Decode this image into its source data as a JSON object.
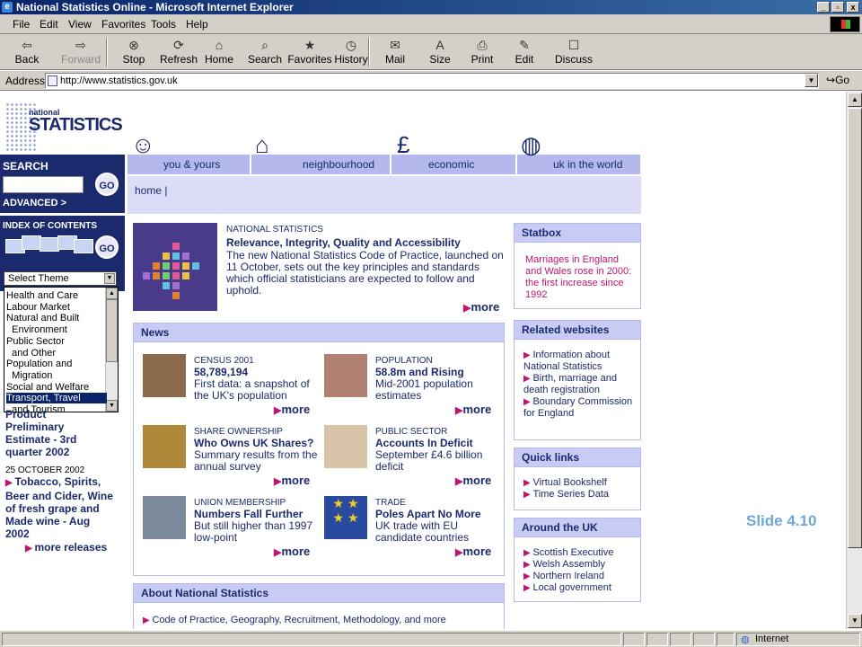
{
  "window": {
    "title": "National Statistics Online - Microsoft Internet Explorer",
    "controls": [
      "_",
      "▫",
      "x"
    ]
  },
  "menu": [
    "File",
    "Edit",
    "View",
    "Favorites",
    "Tools",
    "Help"
  ],
  "toolbar": [
    {
      "label": "Back",
      "icon": "back-arrow-icon",
      "glyph": "⇦",
      "enabled": true
    },
    {
      "label": "Forward",
      "icon": "forward-arrow-icon",
      "glyph": "⇨",
      "enabled": false
    },
    {
      "label": "Stop",
      "icon": "stop-icon",
      "glyph": "⊗",
      "enabled": true
    },
    {
      "label": "Refresh",
      "icon": "refresh-icon",
      "glyph": "⟳",
      "enabled": true
    },
    {
      "label": "Home",
      "icon": "home-icon",
      "glyph": "⌂",
      "enabled": true
    },
    {
      "label": "Search",
      "icon": "search-icon",
      "glyph": "⌕",
      "enabled": true
    },
    {
      "label": "Favorites",
      "icon": "favorites-icon",
      "glyph": "★",
      "enabled": true
    },
    {
      "label": "History",
      "icon": "history-icon",
      "glyph": "◷",
      "enabled": true
    },
    {
      "label": "Mail",
      "icon": "mail-icon",
      "glyph": "✉",
      "enabled": true
    },
    {
      "label": "Size",
      "icon": "text-size-icon",
      "glyph": "A",
      "enabled": true
    },
    {
      "label": "Print",
      "icon": "print-icon",
      "glyph": "⎙",
      "enabled": true
    },
    {
      "label": "Edit",
      "icon": "edit-icon",
      "glyph": "✎",
      "enabled": true
    },
    {
      "label": "Discuss",
      "icon": "discuss-icon",
      "glyph": "☐",
      "enabled": true
    }
  ],
  "address": {
    "label": "Address",
    "url": "http://www.statistics.gov.uk",
    "go": "Go"
  },
  "site": {
    "logo_top": "national",
    "logo_main": "STATISTICS",
    "search": {
      "label": "SEARCH",
      "go": "GO",
      "advanced": "ADVANCED >"
    },
    "index": {
      "label": "INDEX OF CONTENTS",
      "go": "GO",
      "select_value": "Select Theme"
    },
    "theme_options": [
      "Health and Care",
      "Labour Market",
      "Natural and Built",
      "  Environment",
      "Public Sector",
      "  and Other",
      "Population and",
      "  Migration",
      "Social and Welfare",
      "Transport, Travel",
      "  and Tourism"
    ],
    "theme_selected_index": 9,
    "releases": {
      "partial_lines": [
        "Product",
        "Preliminary",
        "Estimate - 3rd",
        "quarter 2002"
      ],
      "date": "25 OCTOBER 2002",
      "item": "Tobacco, Spirits, Beer and Cider, Wine of fresh grape and Made wine - Aug 2002",
      "more": "more releases"
    },
    "tabs": [
      {
        "label": "you & yours",
        "icon": "people-icon",
        "glyph": "☺"
      },
      {
        "label": "neighbourhood",
        "icon": "houses-icon",
        "glyph": "⌂"
      },
      {
        "label": "economic",
        "icon": "money-icon",
        "glyph": "£"
      },
      {
        "label": "uk in the world",
        "icon": "globe-icon",
        "glyph": "◍"
      }
    ],
    "breadcrumb": "home |",
    "feature": {
      "category": "NATIONAL STATISTICS",
      "headline": "Relevance, Integrity, Quality and Accessibility",
      "body": "The new National Statistics Code of Practice, launched on 11 October, sets out the key principles and standards which official statisticians are expected to follow and uphold.",
      "more": "more"
    },
    "news": {
      "title": "News",
      "items": [
        {
          "category": "CENSUS 2001",
          "headline": "58,789,194",
          "body": "First data: a snapshot of the UK's population",
          "more": "more",
          "img": "census-photo"
        },
        {
          "category": "POPULATION",
          "headline": "58.8m and Rising",
          "body": "Mid-2001 population estimates",
          "more": "more",
          "img": "crowd-photo"
        },
        {
          "category": "SHARE OWNERSHIP",
          "headline": "Who Owns UK Shares?",
          "body": "Summary results from the annual survey",
          "more": "more",
          "img": "coins-photo"
        },
        {
          "category": "PUBLIC SECTOR",
          "headline": "Accounts In Deficit",
          "body": "September £4.6 billion deficit",
          "more": "more",
          "img": "ledger-photo"
        },
        {
          "category": "UNION MEMBERSHIP",
          "headline": "Numbers Fall Further",
          "body": "But still higher than 1997 low-point",
          "more": "more",
          "img": "worker-photo"
        },
        {
          "category": "TRADE",
          "headline": "Poles Apart No More",
          "body": "UK trade with EU candidate countries",
          "more": "more",
          "img": "eu-flag-photo"
        }
      ]
    },
    "about": {
      "title": "About National Statistics",
      "text": "Code of Practice, Geography, Recruitment, Methodology, and more"
    },
    "statbox": {
      "title": "Statbox",
      "text": "Marriages in England and Wales rose in 2000: the first increase since 1992"
    },
    "related": {
      "title": "Related websites",
      "items": [
        "Information about National Statistics",
        "Birth, marriage and death registration",
        "Boundary Commission for England"
      ]
    },
    "quick": {
      "title": "Quick links",
      "items": [
        "Virtual Bookshelf",
        "Time Series Data"
      ]
    },
    "around": {
      "title": "Around the UK",
      "items": [
        "Scottish Executive",
        "Welsh Assembly",
        "Northern Ireland",
        "Local government"
      ]
    }
  },
  "slide_label": "Slide 4.10",
  "status": {
    "zone": "Internet"
  },
  "colors": {
    "navy": "#1a2a6c",
    "accent": "#c0156e",
    "tab": "#b4b8ec"
  }
}
